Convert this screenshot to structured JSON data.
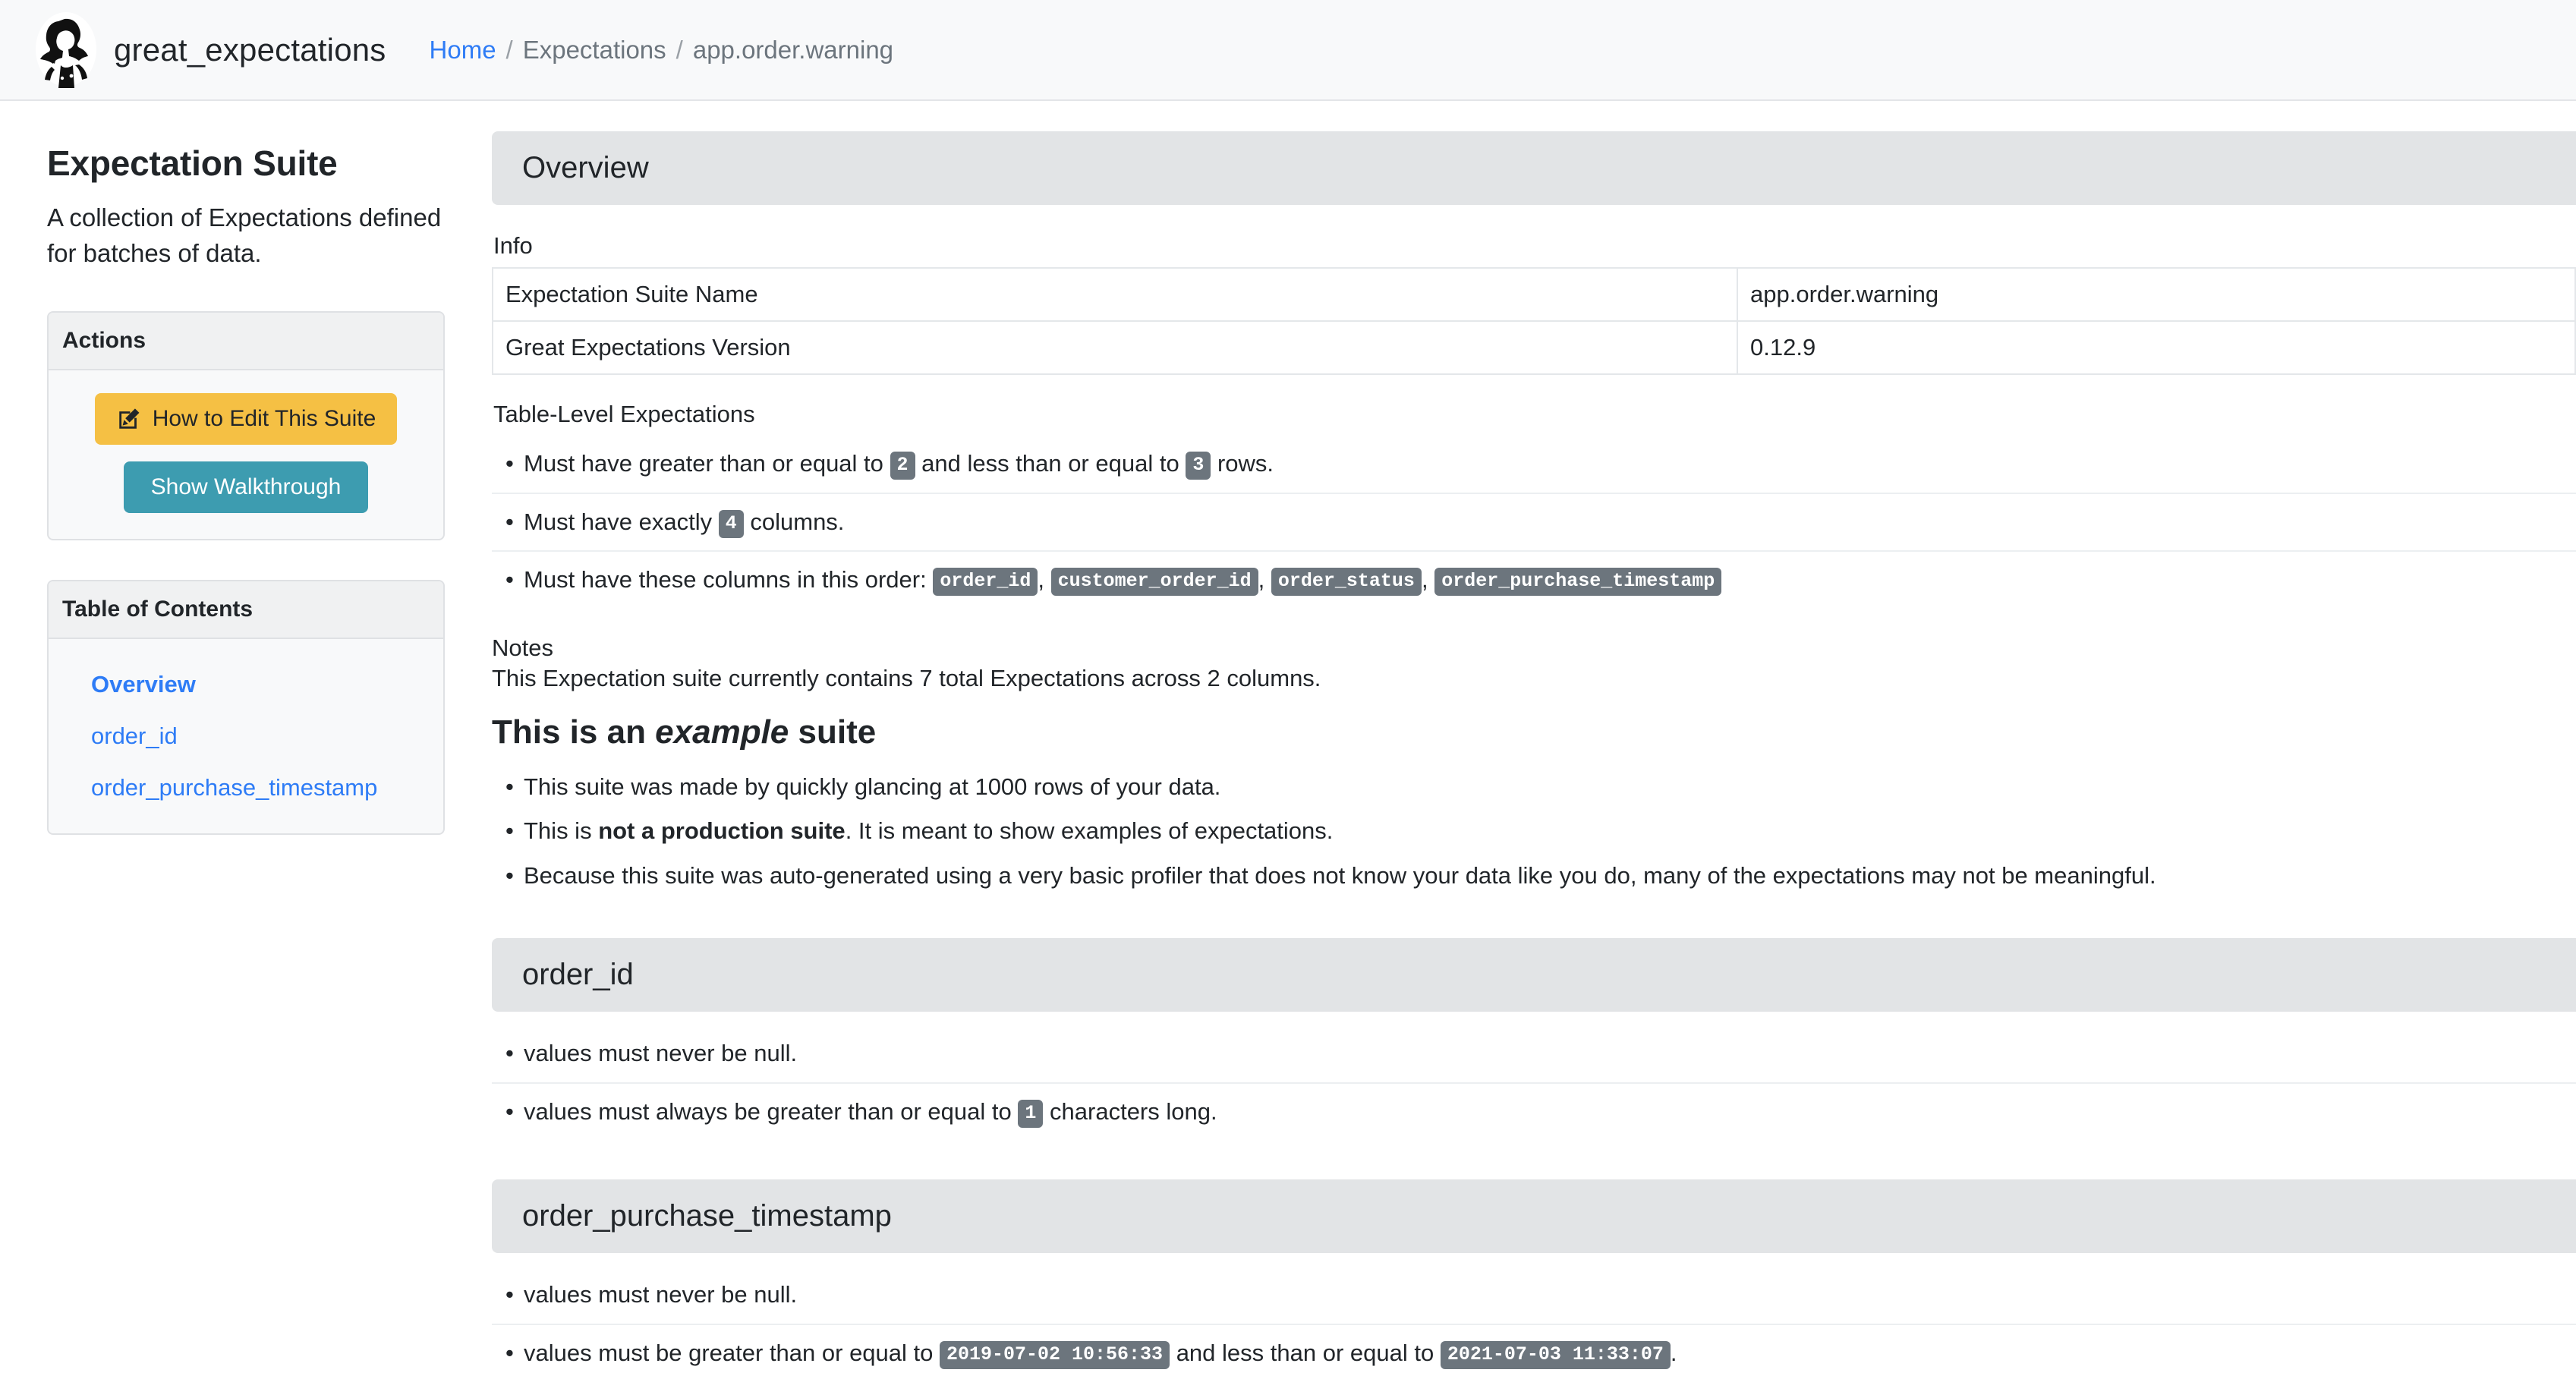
{
  "navbar": {
    "brand": "great_expectations",
    "logo_alt": "great-expectations-logo",
    "breadcrumb": {
      "home": "Home",
      "sep1": "/",
      "section": "Expectations",
      "sep2": "/",
      "current": "app.order.warning"
    }
  },
  "sidebar": {
    "title": "Expectation Suite",
    "description": "A collection of Expectations defined for batches of data.",
    "actions": {
      "header": "Actions",
      "edit_button": "How to Edit This Suite",
      "edit_icon": "pen-to-square-icon",
      "walkthrough_button": "Show Walkthrough"
    },
    "toc": {
      "header": "Table of Contents",
      "items": [
        {
          "label": "Overview",
          "active": true
        },
        {
          "label": "order_id",
          "active": false
        },
        {
          "label": "order_purchase_timestamp",
          "active": false
        }
      ]
    }
  },
  "content": {
    "overview": {
      "header": "Overview",
      "info_label": "Info",
      "info_rows": [
        {
          "key": "Expectation Suite Name",
          "value": "app.order.warning"
        },
        {
          "key": "Great Expectations Version",
          "value": "0.12.9"
        }
      ],
      "table_level_label": "Table-Level Expectations",
      "expectations": {
        "rows_pre": "Must have greater than or equal to",
        "rows_min": "2",
        "rows_mid": "and less than or equal to",
        "rows_max": "3",
        "rows_post": "rows.",
        "cols_pre": "Must have exactly",
        "cols_count": "4",
        "cols_post": "columns.",
        "order_pre": "Must have these columns in this order:",
        "columns": [
          "order_id",
          "customer_order_id",
          "order_status",
          "order_purchase_timestamp"
        ]
      },
      "notes_label": "Notes",
      "notes_text": "This Expectation suite currently contains 7 total Expectations across 2 columns.",
      "example_heading_pre": "This is an ",
      "example_heading_em": "example",
      "example_heading_post": " suite",
      "example_bullets": {
        "b1": "This suite was made by quickly glancing at 1000 rows of your data.",
        "b2_pre": "This is ",
        "b2_bold": "not a production suite",
        "b2_post": ". It is meant to show examples of expectations.",
        "b3": "Because this suite was auto-generated using a very basic profiler that does not know your data like you do, many of the expectations may not be meaningful."
      }
    },
    "order_id": {
      "header": "order_id",
      "null_rule": "values must never be null.",
      "length_pre": "values must always be greater than or equal to",
      "length_value": "1",
      "length_post": "characters long."
    },
    "order_purchase_timestamp": {
      "header": "order_purchase_timestamp",
      "null_rule": "values must never be null.",
      "range_pre": "values must be greater than or equal to",
      "range_min": "2019-07-02 10:56:33",
      "range_mid": "and less than or equal to",
      "range_max": "2021-07-03 11:33:07",
      "range_post": "."
    }
  },
  "colors": {
    "link": "#2e7cf6",
    "badge": "#6c757d",
    "edit_button": "#f5c044",
    "walkthrough_button": "#3d9cb0",
    "section_header": "#e2e4e6",
    "navbar": "#f8f9fa"
  }
}
